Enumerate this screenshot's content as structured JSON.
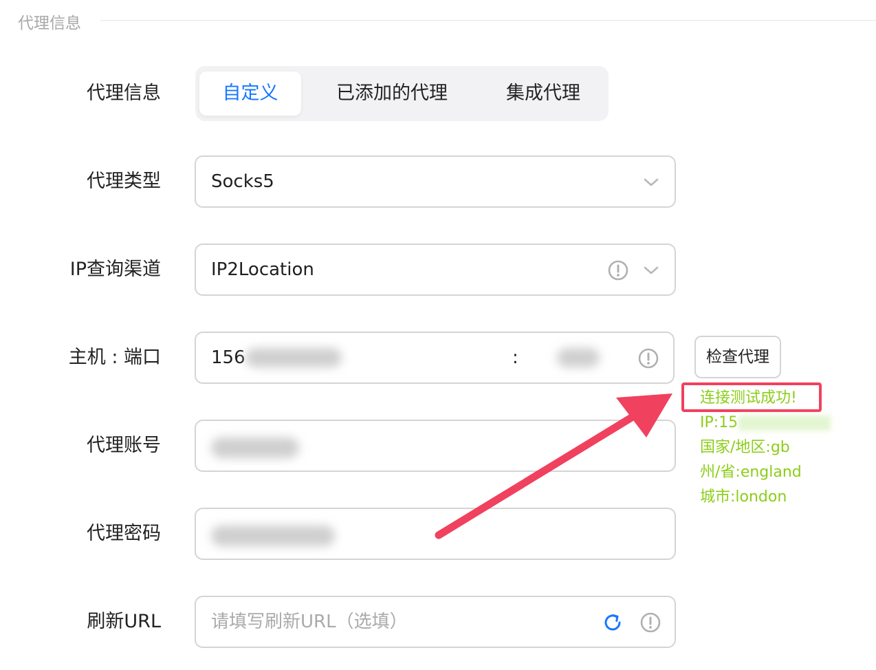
{
  "section": {
    "title": "代理信息"
  },
  "labels": {
    "proxy_info": "代理信息",
    "proxy_type": "代理类型",
    "ip_channel": "IP查询渠道",
    "host_port": "主机 : 端口",
    "account": "代理账号",
    "password": "代理密码",
    "refresh_url": "刷新URL"
  },
  "tabs": [
    {
      "label": "自定义",
      "active": true
    },
    {
      "label": "已添加的代理",
      "active": false
    },
    {
      "label": "集成代理",
      "active": false
    }
  ],
  "fields": {
    "proxy_type": "Socks5",
    "ip_channel": "IP2Location",
    "host_prefix": "156",
    "port_separator": ":",
    "refresh_placeholder": "请填写刷新URL（选填）"
  },
  "buttons": {
    "check_proxy": "检查代理"
  },
  "result": {
    "status": "连接测试成功!",
    "ip": "IP:15",
    "country": "国家/地区:gb",
    "state": "州/省:england",
    "city": "城市:london"
  },
  "colors": {
    "accent": "#1677ff",
    "success": "#8ccd18",
    "highlight": "#f0415e"
  }
}
